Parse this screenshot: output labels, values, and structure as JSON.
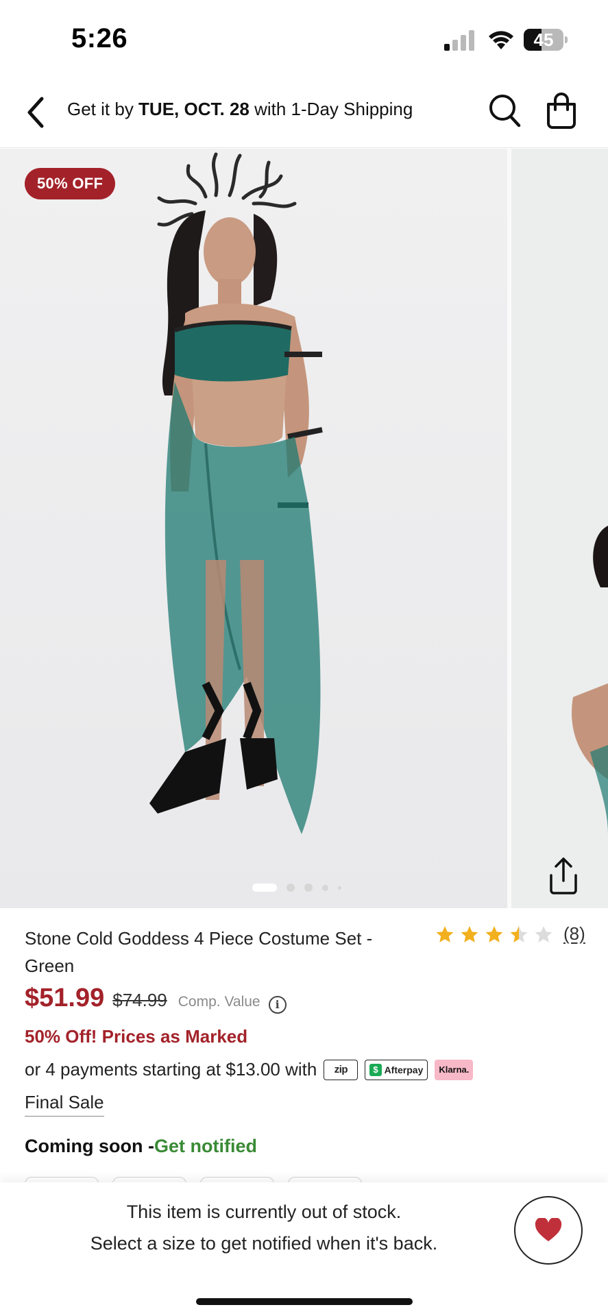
{
  "status_bar": {
    "time": "5:26",
    "battery_level": "45",
    "battery_fraction": 0.45
  },
  "nav": {
    "shipping_prefix": "Get it by ",
    "shipping_date": "TUE, OCT. 28",
    "shipping_suffix": " with 1-Day Shipping",
    "icons": [
      "back-arrow-icon",
      "search-icon",
      "shopping-bag-icon"
    ]
  },
  "gallery": {
    "badge": "50% OFF",
    "image_count": 5,
    "active_index": 0,
    "share_icon": "share-icon"
  },
  "product": {
    "title": "Stone Cold Goddess 4 Piece Costume Set - Green",
    "rating": {
      "stars": 3.5,
      "max": 5,
      "count_label": "(8)",
      "star_color": "#f2b01e"
    },
    "price_sale": "$51.99",
    "price_original": "$74.99",
    "comp_value_label": "Comp. Value",
    "info_icon": "i",
    "promo": "50% Off! Prices as Marked",
    "installments_text": "or 4 payments starting at $13.00 with",
    "payment_badges": {
      "zip": "zip",
      "afterpay": "Afterpay",
      "klarna": "Klarna."
    },
    "final_sale": "Final Sale",
    "coming_soon": "Coming soon -",
    "get_notified": "Get notified"
  },
  "bottom": {
    "line1": "This item is currently out of stock.",
    "line2": "Select a size to get notified when it's back.",
    "wishlist_icon": "heart-icon"
  },
  "colors": {
    "brand_red": "#a3222a",
    "notify_green": "#3a8a36",
    "heart_red": "#c0303a"
  }
}
